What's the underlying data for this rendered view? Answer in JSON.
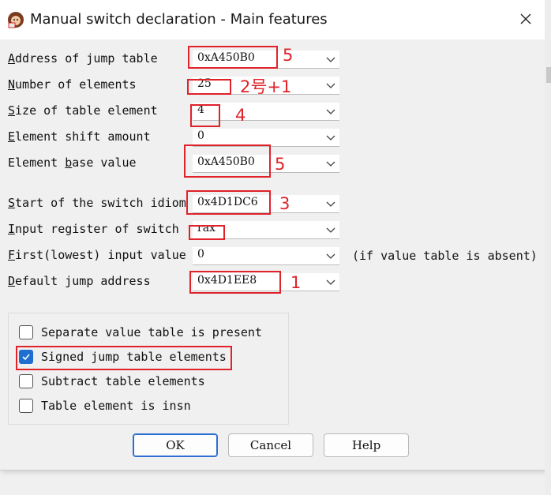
{
  "window": {
    "title": "Manual switch declaration - Main features",
    "icon": "ida-app-icon",
    "close_icon": "close-icon"
  },
  "fields": [
    {
      "pre": "",
      "ul": "A",
      "post": "ddress of jump table",
      "value": "0xA450B0"
    },
    {
      "pre": "",
      "ul": "N",
      "post": "umber of elements",
      "value": "25"
    },
    {
      "pre": "",
      "ul": "S",
      "post": "ize of table element",
      "value": "4"
    },
    {
      "pre": "",
      "ul": "E",
      "post": "lement shift amount",
      "value": "0"
    },
    {
      "pre": "Element ",
      "ul": "b",
      "post": "ase value",
      "value": "0xA450B0"
    },
    {
      "pre": "",
      "ul": "S",
      "post": "tart of the switch idiom",
      "value": "0x4D1DC6"
    },
    {
      "pre": "",
      "ul": "I",
      "post": "nput register of switch",
      "value": "rax"
    },
    {
      "pre": "",
      "ul": "F",
      "post": "irst(lowest) input value",
      "value": "0"
    },
    {
      "pre": "",
      "ul": "D",
      "post": "efault jump address",
      "value": "0x4D1EE8"
    }
  ],
  "first_value_note": "(if value table is absent)",
  "checkboxes": [
    {
      "label": "Separate value table is present",
      "checked": false
    },
    {
      "label": "Signed jump table elements",
      "checked": true
    },
    {
      "label": "Subtract table elements",
      "checked": false
    },
    {
      "label": "Table element is insn",
      "checked": false
    }
  ],
  "buttons": {
    "ok": "OK",
    "cancel": "Cancel",
    "help": "Help"
  },
  "annotations": {
    "address_of_jump_table": "5",
    "number_of_elements": "2号+1",
    "size_of_table_element": "4",
    "element_base_value": "5",
    "start_of_switch_idiom": "3",
    "default_jump_address": "1"
  },
  "colors": {
    "accent": "#1f6fd1",
    "annotation": "#e0222a",
    "background": "#f0f0f0"
  }
}
